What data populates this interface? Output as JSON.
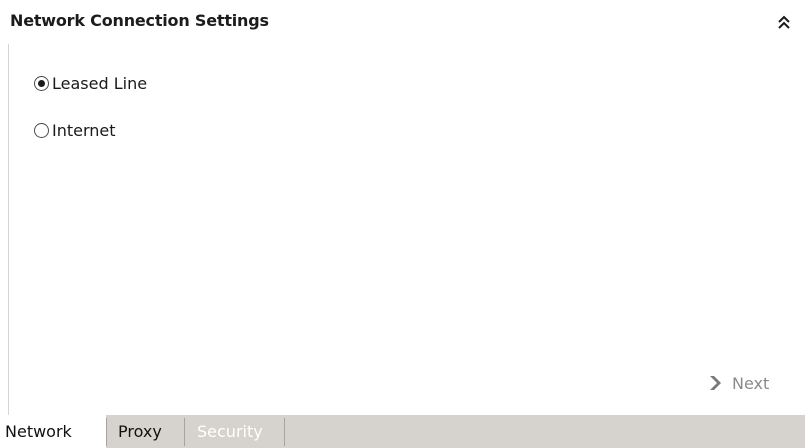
{
  "header": {
    "title": "Network Connection Settings",
    "collapse_icon": "double-chevron-up-icon"
  },
  "connection_type": {
    "options": [
      {
        "label": "Leased Line",
        "checked": true
      },
      {
        "label": "Internet",
        "checked": false
      }
    ]
  },
  "footer": {
    "next_label": "Next",
    "next_icon": "chevron-right-icon",
    "next_enabled": false
  },
  "tabs": [
    {
      "label": "Network",
      "state": "active"
    },
    {
      "label": "Proxy",
      "state": "normal"
    },
    {
      "label": "Security",
      "state": "disabled"
    }
  ],
  "colors": {
    "tabbar_bg": "#d6d3ce",
    "disabled_text": "#8a8a8a"
  }
}
